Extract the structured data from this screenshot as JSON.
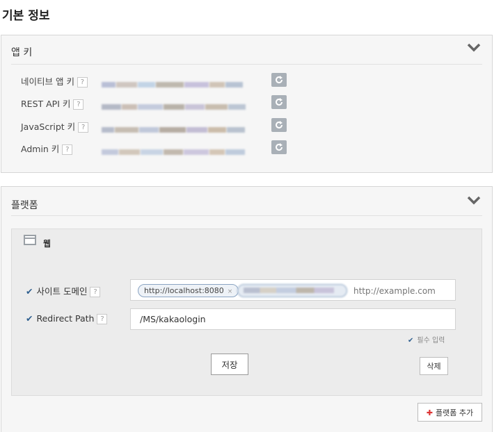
{
  "page_title": "기본 정보",
  "app_keys": {
    "title": "앱 키",
    "help_label": "?",
    "rows": [
      {
        "label": "네이티브 앱 키"
      },
      {
        "label": "REST API 키"
      },
      {
        "label": "JavaScript 키"
      },
      {
        "label": "Admin 키"
      }
    ]
  },
  "platform": {
    "title": "플랫폼",
    "web": {
      "label": "웹",
      "help_label": "?",
      "site_domain": {
        "label": "사이트 도메인",
        "tags": [
          "http://localhost:8080"
        ],
        "tag_remove": "×",
        "placeholder": "http://example.com"
      },
      "redirect_path": {
        "label": "Redirect Path",
        "value": "/MS/kakaologin"
      },
      "required_note": "필수 입력",
      "save_label": "저장",
      "delete_label": "삭제"
    },
    "add_label": "플랫폼 추가",
    "add_icon": "plus-icon"
  },
  "colors": {
    "check": "#2f5f8f",
    "refresh_button": "#a9b0b7",
    "add_plus": "#dd3333"
  }
}
